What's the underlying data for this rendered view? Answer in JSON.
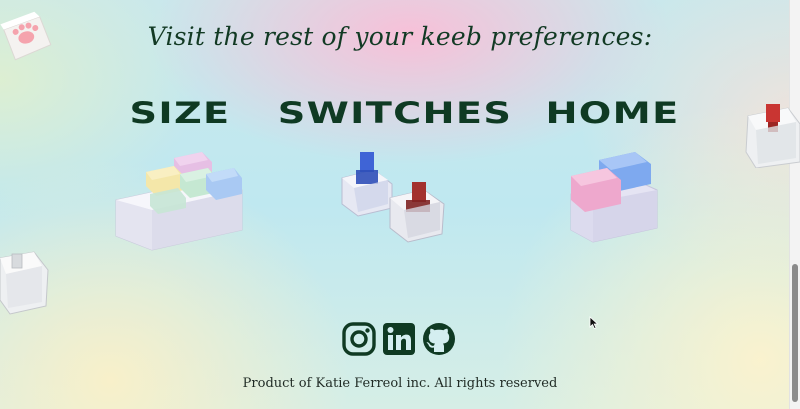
{
  "heading": "Visit the rest of your keeb preferences:",
  "categories": [
    {
      "label": "SIZE",
      "art": "compact-keyboard-illustration"
    },
    {
      "label": "SWITCHES",
      "art": "mechanical-switches-illustration"
    },
    {
      "label": "HOME",
      "art": "two-key-keyboard-illustration"
    }
  ],
  "social": [
    {
      "name": "instagram-icon"
    },
    {
      "name": "linkedin-icon"
    },
    {
      "name": "github-icon"
    }
  ],
  "footer": "Product of Katie Ferreol inc. All rights reserved",
  "colors": {
    "heading_text": "#123a24",
    "category_text": "#0f3a23",
    "icon_color": "#0f3a23",
    "background_blue": "#bfe8f0",
    "background_pink": "#fabed7",
    "background_cream": "#fcf3cd"
  }
}
